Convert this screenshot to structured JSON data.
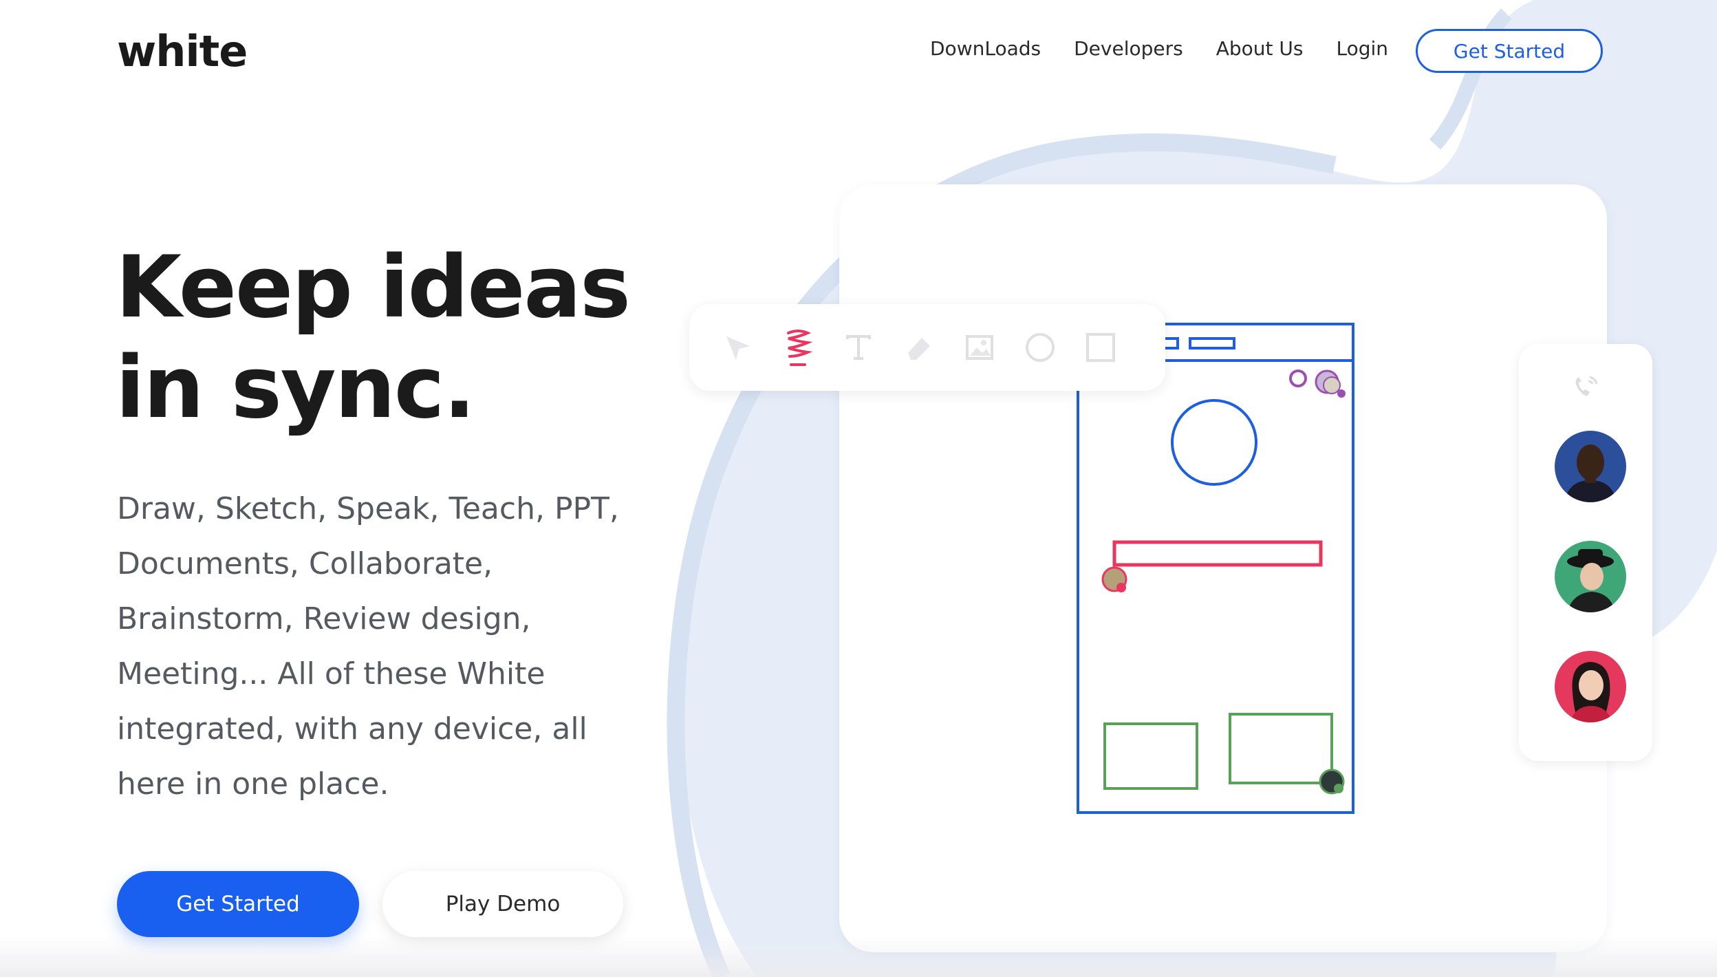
{
  "brand": {
    "logo": "white"
  },
  "nav": {
    "links": [
      "DownLoads",
      "Developers",
      "About Us",
      "Login"
    ],
    "cta": "Get Started"
  },
  "hero": {
    "headline_line1": "Keep ideas",
    "headline_line2": "in sync.",
    "subtext_lines": [
      "Draw, Sketch, Speak, Teach, PPT,",
      "Documents, Collaborate,",
      "Brainstorm, Review design,",
      "Meeting... All of these White",
      "integrated, with any device, all",
      "here in one place."
    ],
    "primary_button": "Get Started",
    "secondary_button": "Play Demo"
  },
  "toolbar": {
    "tools": [
      "selector-icon",
      "pencil-icon",
      "text-icon",
      "eraser-icon",
      "image-icon",
      "circle-icon",
      "rectangle-icon"
    ],
    "active_tool": "pencil-icon"
  },
  "call_panel": {
    "icon": "phone-call-icon",
    "participants": [
      "avatar-1",
      "avatar-2",
      "avatar-3"
    ]
  },
  "colors": {
    "accent": "#1960f0",
    "blob": "#e4ecf7",
    "drawing_blue": "#1e5fe0",
    "drawing_red": "#e8365f",
    "drawing_green": "#5aa05a",
    "drawing_purple": "#9b4fb0"
  }
}
